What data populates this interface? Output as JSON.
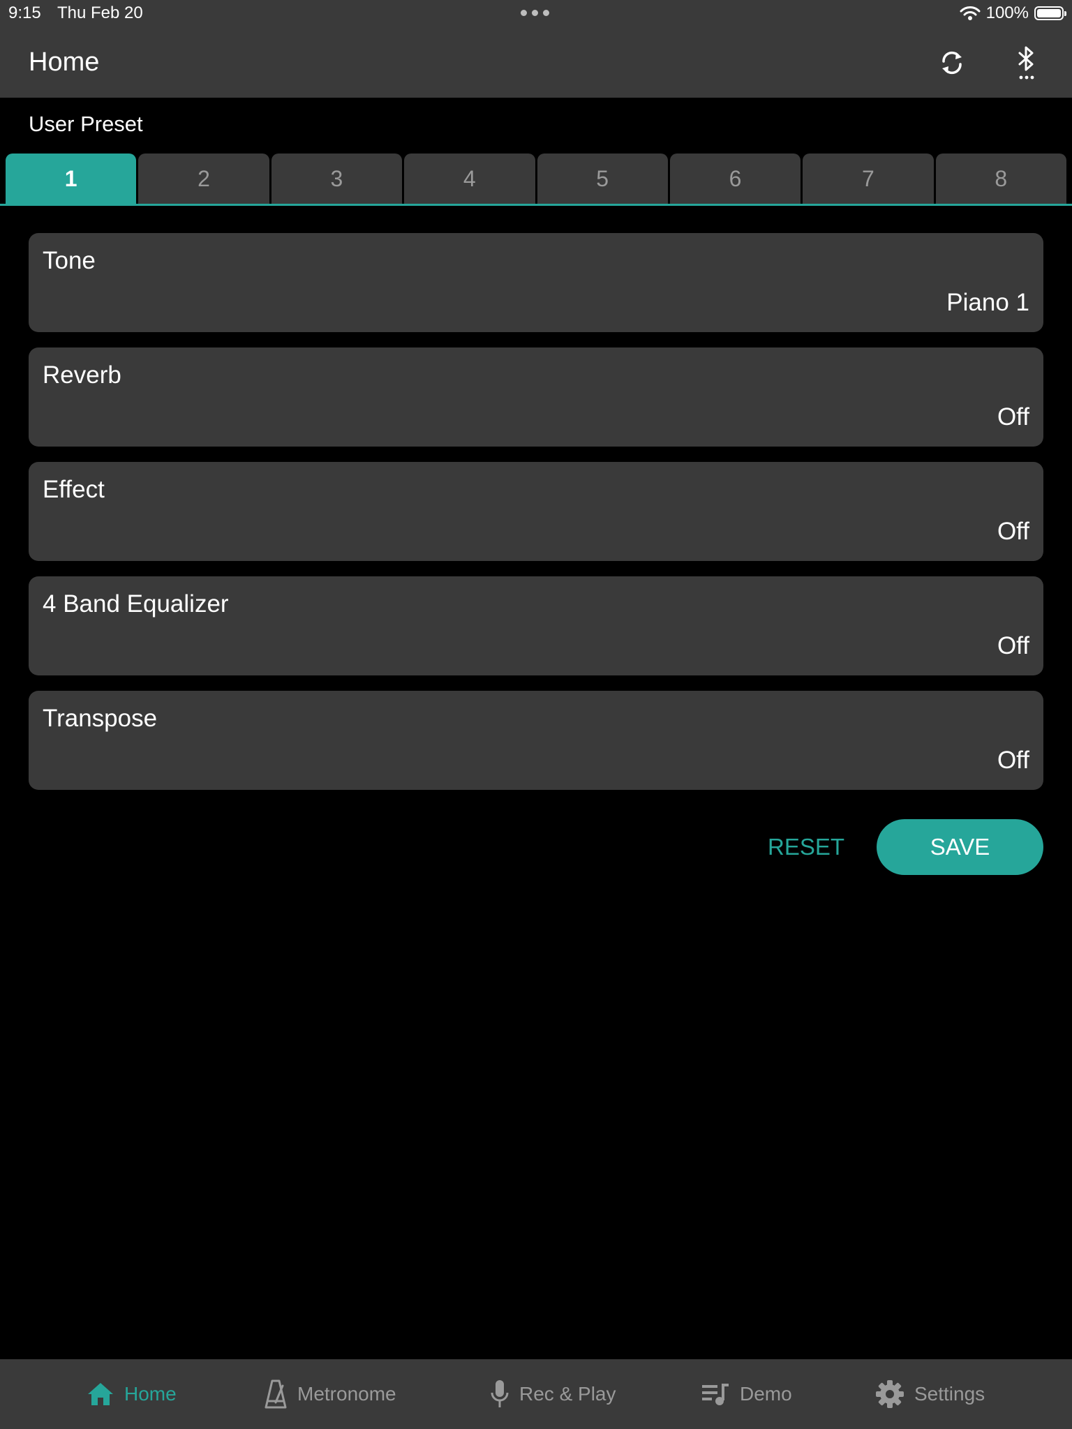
{
  "status_bar": {
    "time": "9:15",
    "date": "Thu Feb 20",
    "battery": "100%"
  },
  "nav": {
    "title": "Home",
    "sync_icon": "sync-icon",
    "bluetooth_icon": "bluetooth-icon"
  },
  "preset": {
    "label": "User Preset",
    "tabs": [
      "1",
      "2",
      "3",
      "4",
      "5",
      "6",
      "7",
      "8"
    ],
    "active_index": 0
  },
  "settings": [
    {
      "title": "Tone",
      "value": "Piano 1"
    },
    {
      "title": "Reverb",
      "value": "Off"
    },
    {
      "title": "Effect",
      "value": "Off"
    },
    {
      "title": "4 Band Equalizer",
      "value": "Off"
    },
    {
      "title": "Transpose",
      "value": "Off"
    }
  ],
  "actions": {
    "reset_label": "RESET",
    "save_label": "SAVE"
  },
  "bottom_nav": [
    {
      "label": "Home",
      "icon": "home-icon",
      "active": true
    },
    {
      "label": "Metronome",
      "icon": "metronome-icon",
      "active": false
    },
    {
      "label": "Rec & Play",
      "icon": "microphone-icon",
      "active": false
    },
    {
      "label": "Demo",
      "icon": "music-list-icon",
      "active": false
    },
    {
      "label": "Settings",
      "icon": "gear-icon",
      "active": false
    }
  ],
  "colors": {
    "accent": "#26a69a",
    "surface": "#3a3a3a",
    "background": "#000000",
    "inactive_text": "#9a9a9a"
  }
}
